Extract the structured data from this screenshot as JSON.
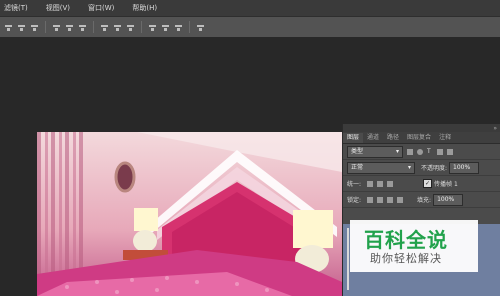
{
  "menu": {
    "items": [
      "滤镜(T)",
      "视图(V)",
      "窗口(W)",
      "帮助(H)"
    ]
  },
  "options_bar": {
    "icons": [
      "align-top-icon",
      "align-vcenter-icon",
      "align-bottom-icon",
      "align-left-icon",
      "align-hcenter-icon",
      "align-right-icon",
      "distribute-top-icon",
      "distribute-vcenter-icon",
      "distribute-bottom-icon",
      "distribute-left-icon",
      "distribute-hcenter-icon",
      "distribute-right-icon",
      "auto-align-icon"
    ]
  },
  "layers_panel": {
    "tabs": [
      "图层",
      "通道",
      "路径",
      "图层复合",
      "注释"
    ],
    "filter": {
      "label": "类型"
    },
    "blend_mode": "正常",
    "opacity": {
      "label": "不透明度:",
      "value": "100%"
    },
    "unify": {
      "label": "统一:",
      "propagate_label": "传播帧 1"
    },
    "lock": {
      "label": "锁定:",
      "fill_label": "填充:",
      "fill_value": "100%"
    }
  },
  "watermark": {
    "title": "百科全说",
    "subtitle": "助你轻松解决"
  },
  "colors": {
    "menubar": "#3a3a3a",
    "options_bar": "#535353",
    "workspace": "#282828",
    "panel": "#4b4b4b",
    "layer_selected": "#6f7fa0",
    "watermark_green": "#22a24c"
  }
}
